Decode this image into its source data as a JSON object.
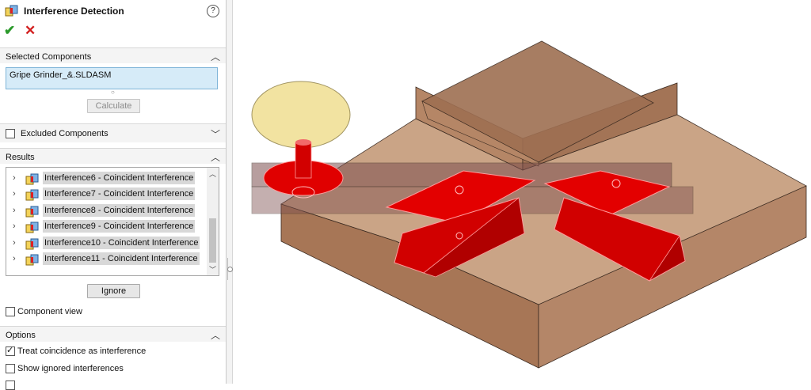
{
  "dialog": {
    "title": "Interference Detection",
    "help_icon": "help-icon",
    "help_glyph": "?",
    "ok_glyph": "✔",
    "cancel_glyph": "✕"
  },
  "selected_components": {
    "title": "Selected Components",
    "value": "Gripe Grinder_&.SLDASM",
    "calculate_label": "Calculate"
  },
  "excluded_components": {
    "title": "Excluded Components",
    "checked": false
  },
  "results": {
    "title": "Results",
    "items": [
      {
        "label": "Interference6 - Coincident Interference"
      },
      {
        "label": "Interference7 - Coincident Interference"
      },
      {
        "label": "Interference8 - Coincident Interference"
      },
      {
        "label": "Interference9 - Coincident Interference"
      },
      {
        "label": "Interference10 - Coincident Interference"
      },
      {
        "label": "Interference11 - Coincident Interference"
      }
    ],
    "ignore_label": "Ignore",
    "component_view_label": "Component view"
  },
  "options": {
    "title": "Options",
    "treat_coincidence_label": "Treat coincidence as interference",
    "treat_coincidence_checked": true,
    "show_ignored_label": "Show ignored interferences",
    "show_ignored_checked": false
  },
  "colors": {
    "body_tan": "#a9795a",
    "interference_red": "#e30000",
    "knob_yellow": "#f0dd8a",
    "accent_blue": "#d6ebf8"
  }
}
